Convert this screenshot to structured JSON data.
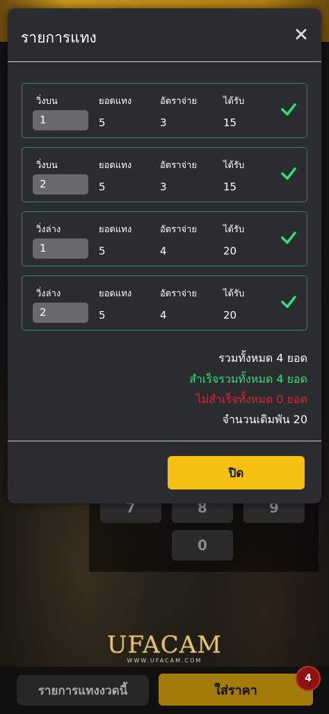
{
  "modal": {
    "title": "รายการแทง",
    "bets": [
      {
        "type": "วิ่งบน",
        "number": "1",
        "amount_label": "ยอดแทง",
        "amount": "5",
        "rate_label": "อัตราจ่าย",
        "rate": "3",
        "win_label": "ได้รับ",
        "win": "15"
      },
      {
        "type": "วิ่งบน",
        "number": "2",
        "amount_label": "ยอดแทง",
        "amount": "5",
        "rate_label": "อัตราจ่าย",
        "rate": "3",
        "win_label": "ได้รับ",
        "win": "15"
      },
      {
        "type": "วิ่งล่าง",
        "number": "1",
        "amount_label": "ยอดแทง",
        "amount": "5",
        "rate_label": "อัตราจ่าย",
        "rate": "4",
        "win_label": "ได้รับ",
        "win": "20"
      },
      {
        "type": "วิ่งล่าง",
        "number": "2",
        "amount_label": "ยอดแทง",
        "amount": "5",
        "rate_label": "อัตราจ่าย",
        "rate": "4",
        "win_label": "ได้รับ",
        "win": "20"
      }
    ],
    "summary": {
      "total": "รวมทั้งหมด 4 ยอด",
      "success": "สำเร็จรวมทั้งหมด 4 ยอด",
      "failed": "ไม่สำเร็จทั้งหมด 0 ยอด",
      "stake": "จำนวนเดิมพัน 20"
    },
    "close_label": "ปิด"
  },
  "keypad": {
    "keys": [
      "7",
      "8",
      "9",
      "0"
    ]
  },
  "brand": {
    "name": "UFACAM",
    "url": "WWW.UFACAM.COM"
  },
  "bottom": {
    "history_label": "รายการแทงงวดนี้",
    "price_label": "ใส่ราคา",
    "badge_count": "4"
  },
  "colors": {
    "accent": "#f5c012",
    "card_border": "#2f8a54",
    "success": "#2ee07a",
    "fail": "#e3242b",
    "check": "#2ee07a"
  },
  "icons": {
    "close": "close-icon",
    "check": "check-icon"
  }
}
